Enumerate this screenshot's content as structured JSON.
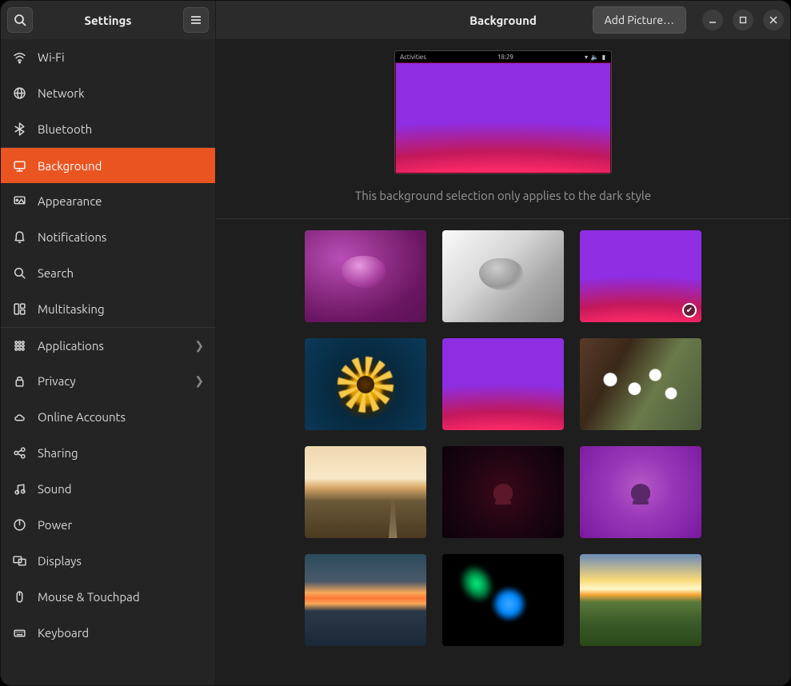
{
  "window": {
    "app_title": "Settings",
    "page_title": "Background",
    "add_picture_label": "Add Picture…"
  },
  "preview": {
    "topbar_left": "Activities",
    "topbar_center": "18:29",
    "hint": "This background selection only applies to the dark style"
  },
  "sidebar": {
    "items": [
      {
        "id": "wifi",
        "label": "Wi-Fi",
        "icon": "wifi"
      },
      {
        "id": "network",
        "label": "Network",
        "icon": "globe"
      },
      {
        "id": "bluetooth",
        "label": "Bluetooth",
        "icon": "bluetooth"
      },
      {
        "id": "background",
        "label": "Background",
        "icon": "monitor",
        "active": true,
        "sep": true
      },
      {
        "id": "appearance",
        "label": "Appearance",
        "icon": "appearance"
      },
      {
        "id": "notifications",
        "label": "Notifications",
        "icon": "bell"
      },
      {
        "id": "search",
        "label": "Search",
        "icon": "search"
      },
      {
        "id": "multitasking",
        "label": "Multitasking",
        "icon": "multitask"
      },
      {
        "id": "applications",
        "label": "Applications",
        "icon": "grid",
        "chevron": true,
        "sep": true
      },
      {
        "id": "privacy",
        "label": "Privacy",
        "icon": "lock",
        "chevron": true
      },
      {
        "id": "online-accounts",
        "label": "Online Accounts",
        "icon": "cloud"
      },
      {
        "id": "sharing",
        "label": "Sharing",
        "icon": "share"
      },
      {
        "id": "sound",
        "label": "Sound",
        "icon": "note"
      },
      {
        "id": "power",
        "label": "Power",
        "icon": "power"
      },
      {
        "id": "displays",
        "label": "Displays",
        "icon": "displays"
      },
      {
        "id": "mouse",
        "label": "Mouse & Touchpad",
        "icon": "mouse"
      },
      {
        "id": "keyboard",
        "label": "Keyboard",
        "icon": "keyboard"
      }
    ]
  },
  "wallpapers": [
    {
      "id": "jelly-purple",
      "class": "bg-jelly-purple",
      "selected": false
    },
    {
      "id": "jelly-grey",
      "class": "bg-jelly-grey",
      "selected": false
    },
    {
      "id": "waves",
      "class": "bg-waves-small",
      "selected": true
    },
    {
      "id": "flower",
      "class": "bg-flower",
      "selected": false
    },
    {
      "id": "waves-2",
      "class": "bg-waves-small",
      "selected": false
    },
    {
      "id": "cherry",
      "class": "bg-cherry",
      "selected": false
    },
    {
      "id": "road",
      "class": "bg-road",
      "selected": false
    },
    {
      "id": "dark-jelly",
      "class": "bg-dark-jelly",
      "selected": false
    },
    {
      "id": "purple-jelly",
      "class": "bg-purple-jelly",
      "selected": false
    },
    {
      "id": "lake",
      "class": "bg-lake",
      "selected": false
    },
    {
      "id": "abstract-blue",
      "class": "bg-abstract-blue",
      "selected": false
    },
    {
      "id": "landscape",
      "class": "bg-landscape",
      "selected": false
    }
  ]
}
